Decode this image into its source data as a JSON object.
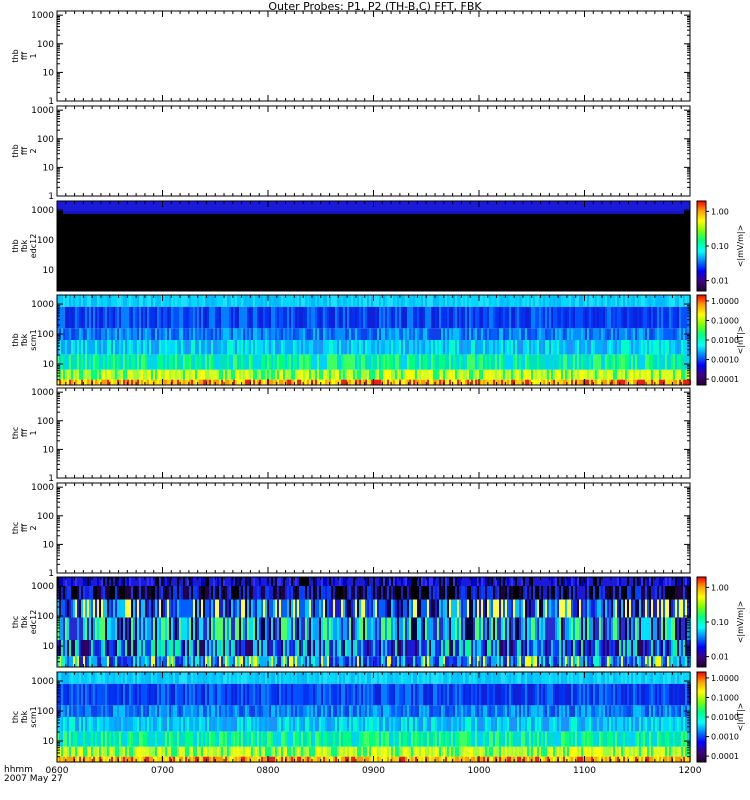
{
  "page": {
    "title": "Outer Probes: P1, P2 (TH-B,C) FFT, FBK"
  },
  "time_axis": {
    "tick_labels": [
      "0600",
      "0700",
      "0800",
      "0900",
      "1000",
      "1100",
      "1200"
    ],
    "footer_line1": "hhmm",
    "footer_line2": "2007 May 27"
  },
  "colors": {
    "frame": "#000000",
    "background": "#ffffff"
  },
  "chart_data": [
    {
      "type": "heatmap",
      "probe": "thb",
      "instrument": "fff",
      "channel": "1",
      "ylabel_lines": [
        "thb",
        "fff",
        "1"
      ],
      "yscale": "log",
      "ylim": [
        1,
        1400
      ],
      "y_ticks": [
        "1",
        "10",
        "100",
        "1000"
      ],
      "has_data": false
    },
    {
      "type": "heatmap",
      "probe": "thb",
      "instrument": "fff",
      "channel": "2",
      "ylabel_lines": [
        "thb",
        "fff",
        "2"
      ],
      "yscale": "log",
      "ylim": [
        1,
        1400
      ],
      "y_ticks": [
        "1",
        "10",
        "100",
        "1000"
      ],
      "has_data": false
    },
    {
      "type": "heatmap",
      "probe": "thb",
      "instrument": "fbk",
      "channel": "edc12",
      "ylabel_lines": [
        "thb",
        "fbk",
        "edc12"
      ],
      "yscale": "log",
      "ylim": [
        2,
        2000
      ],
      "y_ticks": [
        "10",
        "100",
        "1000"
      ],
      "has_data": true,
      "pattern": "edc_thb",
      "colorbar": {
        "label": "<|mV/m|>",
        "ticks": [
          "0.01",
          "0.10",
          "1.00"
        ],
        "range": [
          0.005,
          2
        ]
      }
    },
    {
      "type": "heatmap",
      "probe": "thb",
      "instrument": "fbk",
      "channel": "scm1",
      "ylabel_lines": [
        "thb",
        "fbk",
        "scm1"
      ],
      "yscale": "log",
      "ylim": [
        2,
        2000
      ],
      "y_ticks": [
        "10",
        "100",
        "1000"
      ],
      "has_data": true,
      "pattern": "scm",
      "colorbar": {
        "label": "<|nT|>",
        "ticks": [
          "0.0001",
          "0.0010",
          "0.0100",
          "0.1000",
          "1.0000"
        ],
        "range": [
          5e-05,
          2
        ]
      }
    },
    {
      "type": "heatmap",
      "probe": "thc",
      "instrument": "fff",
      "channel": "1",
      "ylabel_lines": [
        "thc",
        "fff",
        "1"
      ],
      "yscale": "log",
      "ylim": [
        1,
        1400
      ],
      "y_ticks": [
        "1",
        "10",
        "100",
        "1000"
      ],
      "has_data": false
    },
    {
      "type": "heatmap",
      "probe": "thc",
      "instrument": "fff",
      "channel": "2",
      "ylabel_lines": [
        "thc",
        "fff",
        "2"
      ],
      "yscale": "log",
      "ylim": [
        1,
        1400
      ],
      "y_ticks": [
        "1",
        "10",
        "100",
        "1000"
      ],
      "has_data": false
    },
    {
      "type": "heatmap",
      "probe": "thc",
      "instrument": "fbk",
      "channel": "edc12",
      "ylabel_lines": [
        "thc",
        "fbk",
        "edc12"
      ],
      "yscale": "log",
      "ylim": [
        2,
        2000
      ],
      "y_ticks": [
        "10",
        "100",
        "1000"
      ],
      "has_data": true,
      "pattern": "edc_thc",
      "colorbar": {
        "label": "<|mV/m|>",
        "ticks": [
          "0.01",
          "0.10",
          "1.00"
        ],
        "range": [
          0.005,
          2
        ]
      }
    },
    {
      "type": "heatmap",
      "probe": "thc",
      "instrument": "fbk",
      "channel": "scm1",
      "ylabel_lines": [
        "thc",
        "fbk",
        "scm1"
      ],
      "yscale": "log",
      "ylim": [
        2,
        2000
      ],
      "y_ticks": [
        "10",
        "100",
        "1000"
      ],
      "has_data": true,
      "pattern": "scm",
      "colorbar": {
        "label": "<|nT|>",
        "ticks": [
          "0.0001",
          "0.0010",
          "0.0100",
          "0.1000",
          "1.0000"
        ],
        "range": [
          5e-05,
          2
        ]
      }
    }
  ]
}
